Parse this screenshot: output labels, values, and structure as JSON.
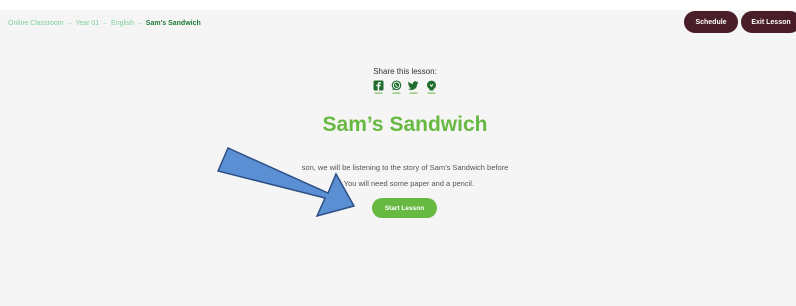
{
  "breadcrumb": {
    "items": [
      "Online Classroom",
      "Year 01",
      "English"
    ],
    "separator": "–",
    "current": "Sam's Sandwich"
  },
  "header": {
    "schedule_label": "Schedule",
    "exit_label": "Exit Lesson"
  },
  "share": {
    "label": "Share this lesson:",
    "icons": [
      "facebook-icon",
      "whatsapp-icon",
      "twitter-icon",
      "google-classroom-icon"
    ]
  },
  "lesson": {
    "title": "Sam’s Sandwich",
    "description_line1": "son, we will be listening to the story of Sam’s Sandwich before",
    "description_line2": "it. You will need some paper and a pencil.",
    "start_label": "Start Lesson"
  },
  "colors": {
    "accent_green": "#67b942",
    "icon_green": "#1f6e2e",
    "dark_button": "#4a1e28",
    "arrow_fill": "#5b8fd4",
    "arrow_stroke": "#2d4f86"
  }
}
